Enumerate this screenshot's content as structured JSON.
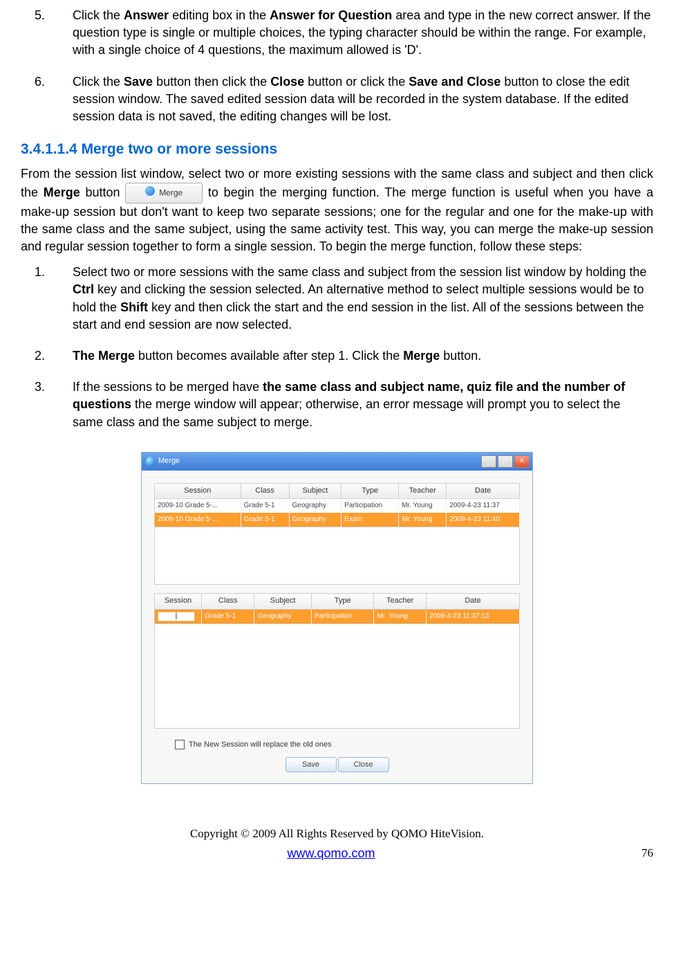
{
  "list": {
    "n5": "5.",
    "t5_a": "Click the ",
    "t5_b": "Answer",
    "t5_c": " editing box in the ",
    "t5_d": "Answer for Question",
    "t5_e": " area and type in the new correct answer. If the question type is single or multiple choices, the typing character should be within the range. For example, with a single choice of 4 questions, the maximum allowed is 'D'.",
    "n6": "6.",
    "t6_a": "Click the ",
    "t6_b": "Save",
    "t6_c": " button then click the ",
    "t6_d": "Close",
    "t6_e": " button or click the ",
    "t6_f": "Save and Close",
    "t6_g": " button to close the edit session window. The saved edited session data will be recorded in the system database.  If the edited session data is not saved, the editing changes will be lost."
  },
  "heading": "3.4.1.1.4  Merge two or more sessions",
  "para1": {
    "a": "From the session list window, select two or more existing sessions with the same class and subject and then click the ",
    "b": "Merge",
    "c": " button ",
    "btn": "Merge",
    "d": " to begin the merging function. The merge function is useful when you have a make-up session but don't want to keep two separate sessions; one for the regular and one for the make-up with the same class and the same subject, using the same activity test. This way, you can merge the make-up session and regular session together to form a single session. To begin the merge function, follow these steps:"
  },
  "steps": {
    "n1": "1.",
    "t1_a": "Select two or more sessions with the same class and subject from the session list window by holding the ",
    "t1_b": "Ctrl",
    "t1_c": " key and clicking the session selected. An alternative method to select multiple sessions would be to hold the ",
    "t1_d": "Shift",
    "t1_e": " key and then click the start and the end session in the list. All of the sessions between the start and end session are now selected.",
    "n2": "2.",
    "t2_a": "The Merge",
    "t2_b": " button becomes available after step 1. Click the ",
    "t2_c": "Merge",
    "t2_d": " button.",
    "n3": "3.",
    "t3_a": "If the sessions to be merged have ",
    "t3_b": "the same class and subject name, quiz file and the number of questions",
    "t3_c": " the merge window will appear; otherwise, an error message will prompt you to select the same class and the same subject to merge."
  },
  "window": {
    "title": "Merge",
    "cols": [
      "Session",
      "Class",
      "Subject",
      "Type",
      "Teacher",
      "Date"
    ],
    "row1": [
      "2009-10 Grade 5-...",
      "Grade 5-1",
      "Geography",
      "Participation",
      "Mr. Young",
      "2009-4-23 11:37"
    ],
    "row2": [
      "2009-10 Grade 5-...",
      "Grade 5-1",
      "Geography",
      "Exam",
      "Mr. Young",
      "2009-4-23 11:40"
    ],
    "row3": [
      "",
      "Grade 5-1",
      "Geography",
      "Participation",
      "Mr. Young",
      "2009-4-23 11:37:13"
    ],
    "caret": "|",
    "checkbox_label": "The New Session will replace the old ones",
    "save": "Save",
    "close": "Close"
  },
  "footer": {
    "copyright": "Copyright © 2009 All Rights Reserved by QOMO HiteVision.",
    "url": "www.qomo.com",
    "page": "76"
  }
}
